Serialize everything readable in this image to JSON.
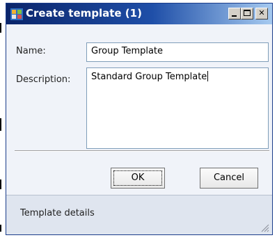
{
  "window": {
    "title": "Create template (1)",
    "icon": "app-icon",
    "controls": {
      "minimize": "minimize-icon",
      "maximize": "maximize-icon",
      "close": "✕"
    }
  },
  "form": {
    "name_label": "Name:",
    "name_value": "Group Template",
    "description_label": "Description:",
    "description_value": "Standard Group Template"
  },
  "buttons": {
    "ok_label": "OK",
    "cancel_label": "Cancel"
  },
  "footer": {
    "status_text": "Template details"
  },
  "colors": {
    "title_bar_start": "#0a246a",
    "title_bar_end": "#a6caf0",
    "content_bg": "#f0f3f9",
    "footer_bg": "#dfe5ef"
  }
}
